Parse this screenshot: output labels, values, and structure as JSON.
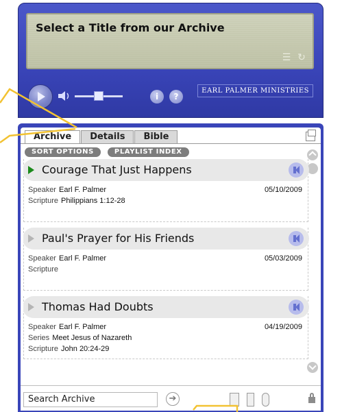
{
  "player": {
    "screen_title": "Select a Title from our Archive",
    "icons": [
      "list-icon",
      "refresh-icon",
      "play-icon",
      "volume-icon",
      "info-icon",
      "help-icon"
    ],
    "brand": "EARL PALMER MINISTRIES"
  },
  "tabs": [
    {
      "label": "Archive",
      "active": true
    },
    {
      "label": "Details",
      "active": false
    },
    {
      "label": "Bible",
      "active": false
    }
  ],
  "pills": [
    "SORT OPTIONS",
    "PLAYLIST INDEX"
  ],
  "items": [
    {
      "title": "Courage That Just Happens",
      "active": true,
      "speaker_label": "Speaker",
      "speaker": "Earl F. Palmer",
      "date": "05/10/2009",
      "scripture_label": "Scripture",
      "scripture": "Philippians 1:12-28"
    },
    {
      "title": "Paul's Prayer for His Friends",
      "active": false,
      "speaker_label": "Speaker",
      "speaker": "Earl F. Palmer",
      "date": "05/03/2009",
      "scripture_label": "Scripture",
      "scripture": ""
    },
    {
      "title": "Thomas Had Doubts",
      "active": false,
      "speaker_label": "Speaker",
      "speaker": "Earl F. Palmer",
      "date": "04/19/2009",
      "series_label": "Series",
      "series": "Meet Jesus of Nazareth",
      "scripture_label": "Scripture",
      "scripture": "John 20:24-29"
    }
  ],
  "search": {
    "value": "Search Archive"
  },
  "colors": {
    "panel": "#3a45b9",
    "annotation": "#f2c232",
    "active_arrow": "#1b8a1b"
  }
}
